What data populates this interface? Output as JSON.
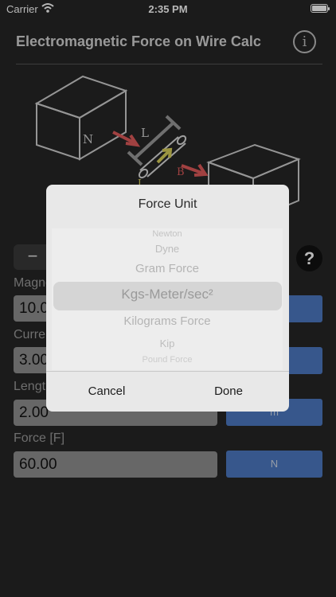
{
  "status_bar": {
    "carrier": "Carrier",
    "time": "2:35 PM",
    "battery_level": 1.0
  },
  "header": {
    "title": "Electromagnetic Force on Wire Calc",
    "info_icon": "i"
  },
  "diagram": {
    "north_label": "N",
    "length_label": "L",
    "field_label": "B",
    "current_label": "I"
  },
  "controls": {
    "minus_label": "−",
    "help_label": "?"
  },
  "fields": [
    {
      "label": "Magnetic Field [B]",
      "value": "10.00",
      "unit": ""
    },
    {
      "label": "Current [I]",
      "value": "3.00",
      "unit": ""
    },
    {
      "label": "Length [L]",
      "value": "2.00",
      "unit": "m"
    },
    {
      "label": "Force [F]",
      "value": "60.00",
      "unit": "N"
    }
  ],
  "dialog": {
    "title": "Force Unit",
    "options": [
      "Newton",
      "Dyne",
      "Gram Force",
      "Kgs-Meter/sec²",
      "Kilograms Force",
      "Kip",
      "Pound Force"
    ],
    "selected": "Kgs-Meter/sec²",
    "cancel_label": "Cancel",
    "done_label": "Done"
  }
}
